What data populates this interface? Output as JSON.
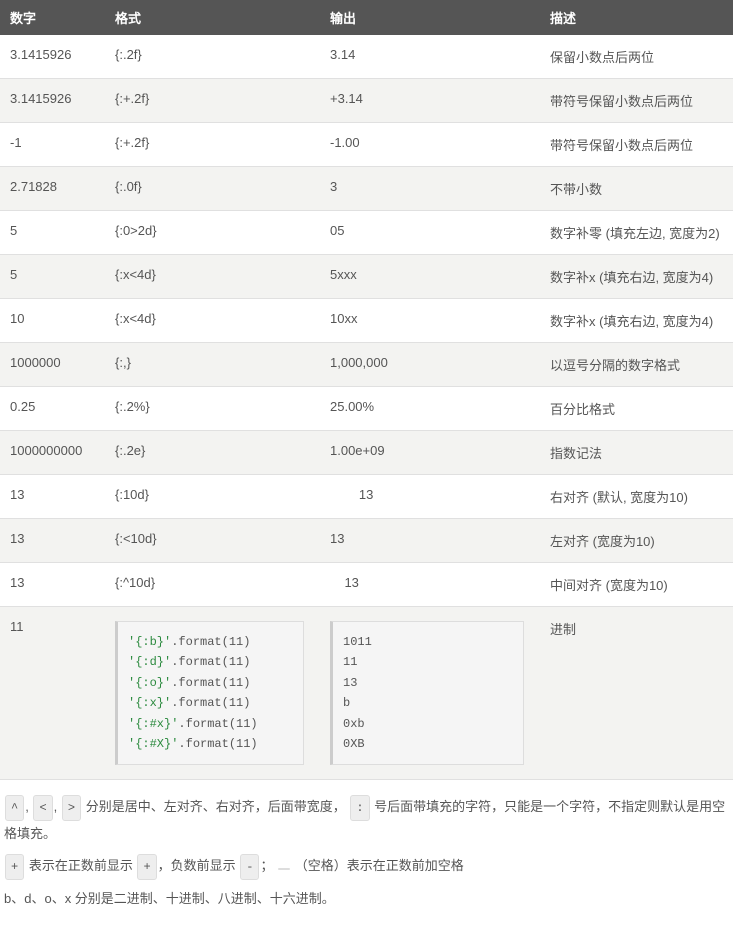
{
  "table": {
    "headers": {
      "number": "数字",
      "format": "格式",
      "output": "输出",
      "desc": "描述"
    },
    "rows": [
      {
        "number": "3.1415926",
        "format": "{:.2f}",
        "output": "3.14",
        "desc": "保留小数点后两位"
      },
      {
        "number": "3.1415926",
        "format": "{:+.2f}",
        "output": "+3.14",
        "desc": "带符号保留小数点后两位"
      },
      {
        "number": "-1",
        "format": "{:+.2f}",
        "output": "-1.00",
        "desc": "带符号保留小数点后两位"
      },
      {
        "number": "2.71828",
        "format": "{:.0f}",
        "output": "3",
        "desc": "不带小数"
      },
      {
        "number": "5",
        "format": "{:0>2d}",
        "output": "05",
        "desc": "数字补零 (填充左边, 宽度为2)"
      },
      {
        "number": "5",
        "format": "{:x<4d}",
        "output": "5xxx",
        "desc": "数字补x (填充右边, 宽度为4)"
      },
      {
        "number": "10",
        "format": "{:x<4d}",
        "output": "10xx",
        "desc": "数字补x (填充右边, 宽度为4)"
      },
      {
        "number": "1000000",
        "format": "{:,}",
        "output": "1,000,000",
        "desc": "以逗号分隔的数字格式"
      },
      {
        "number": "0.25",
        "format": "{:.2%}",
        "output": "25.00%",
        "desc": "百分比格式"
      },
      {
        "number": "1000000000",
        "format": "{:.2e}",
        "output": "1.00e+09",
        "desc": "指数记法"
      },
      {
        "number": "13",
        "format": "{:10d}",
        "output": "        13",
        "desc": "右对齐 (默认, 宽度为10)"
      },
      {
        "number": "13",
        "format": "{:<10d}",
        "output": "13",
        "desc": "左对齐 (宽度为10)"
      },
      {
        "number": "13",
        "format": "{:^10d}",
        "output": "    13",
        "desc": "中间对齐 (宽度为10)"
      }
    ],
    "lastRow": {
      "number": "11",
      "desc": "进制",
      "formatCode": [
        {
          "s": "'{:b}'",
          "r": ".format(11)"
        },
        {
          "s": "'{:d}'",
          "r": ".format(11)"
        },
        {
          "s": "'{:o}'",
          "r": ".format(11)"
        },
        {
          "s": "'{:x}'",
          "r": ".format(11)"
        },
        {
          "s": "'{:#x}'",
          "r": ".format(11)"
        },
        {
          "s": "'{:#X}'",
          "r": ".format(11)"
        }
      ],
      "outputCode": [
        "1011",
        "11",
        "13",
        "b",
        "0xb",
        "0XB"
      ]
    }
  },
  "notes": {
    "keys": {
      "caret": "^",
      "lt": "<",
      "gt": ">",
      "colon": ":",
      "plus": "+",
      "minus": "-",
      "space": " "
    },
    "line1a": " 分别是居中、左对齐、右对齐，后面带宽度，",
    "line1b": " 号后面带填充的字符，只能是一个字符，不指定则默认是用空格填充。",
    "line2a": " 表示在正数前显示 ",
    "line2b": "，负数前显示 ",
    "line2c": "；",
    "line2d": " （空格）表示在正数前加空格",
    "line3": "b、d、o、x 分别是二进制、十进制、八进制、十六进制。"
  }
}
